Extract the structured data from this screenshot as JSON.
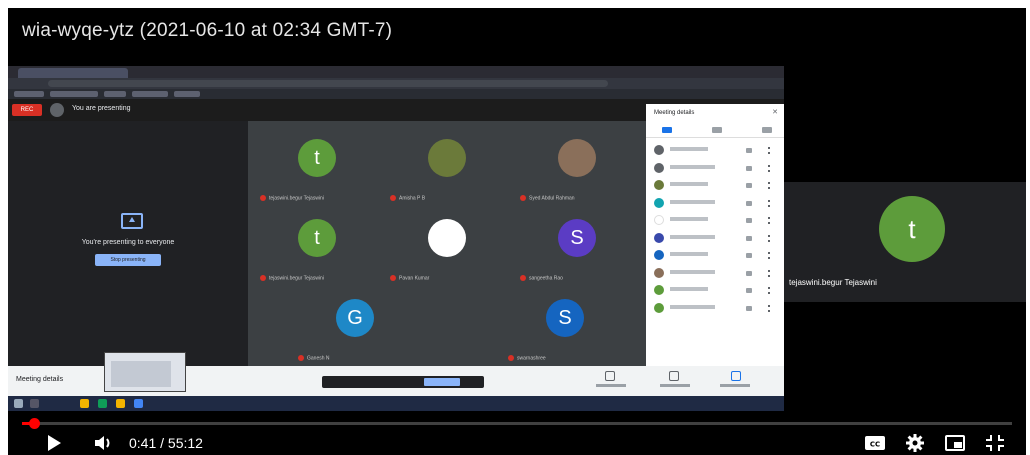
{
  "video": {
    "title": "wia-wyqe-ytz (2021-06-10 at 02:34 GMT-7)"
  },
  "meet": {
    "rec_badge": "REC",
    "presenting_banner": "You are presenting",
    "presenting_message": "You're presenting to everyone",
    "stop_presenting": "Stop presenting",
    "tiles": [
      {
        "initial": "t",
        "color": "#5d9c3b",
        "name": "tejaswini.begur Tejaswini"
      },
      {
        "initial": "",
        "color": "#6b7a3a",
        "name": "Amisha P B"
      },
      {
        "initial": "",
        "color": "#8a6f5a",
        "name": "Syed Abdul Rahman"
      },
      {
        "initial": "t",
        "color": "#5d9c3b",
        "name": "tejaswini.begur Tejaswini"
      },
      {
        "initial": "",
        "color": "#ffffff",
        "name": "Pavan Kumar"
      },
      {
        "initial": "S",
        "color": "#5b3cc4",
        "name": "sangeetha Rao"
      },
      {
        "initial": "G",
        "color": "#1e88c7",
        "name": "Ganesh N"
      },
      {
        "initial": "S",
        "color": "#1565c0",
        "name": "swarnashree"
      }
    ],
    "side_panel": {
      "title": "Meeting details",
      "participants": [
        {
          "color": "#5f6368"
        },
        {
          "color": "#5f6368"
        },
        {
          "color": "#6b7a3a"
        },
        {
          "color": "#12a4b0"
        },
        {
          "color": "#ffffff"
        },
        {
          "color": "#3949ab"
        },
        {
          "color": "#1565c0"
        },
        {
          "color": "#8a6f5a"
        },
        {
          "color": "#5d9c3b"
        },
        {
          "color": "#5d9c3b"
        }
      ]
    },
    "meeting_details_label": "Meeting details",
    "right_participant": {
      "initial": "t",
      "name": "tejaswini.begur Tejaswini"
    }
  },
  "player": {
    "time_display": "0:41 / 55:12",
    "progress_fraction": 0.0124,
    "accent": "#ff0000"
  }
}
